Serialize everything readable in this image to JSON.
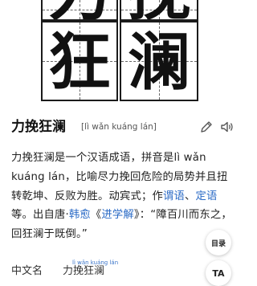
{
  "chars": [
    "力",
    "挽",
    "狂",
    "澜"
  ],
  "title": "力挽狂澜",
  "pinyin": "[lì wǎn kuáng lán]",
  "description": {
    "seg1": "力挽狂澜是一个汉语成语，拼音是lì wǎn kuáng lán，比喻尽力挽回危险的局势并且扭转乾坤、反败为胜。动宾式；作",
    "link1": "谓语",
    "seg2": "、",
    "link2": "定语",
    "seg3": "等。出自唐·",
    "link3": "韩愈",
    "seg4": "《",
    "link4": "进学解",
    "seg5": "》：“障百川而东之，回狂澜于既倒。”"
  },
  "toc_label": "目录",
  "ta_label": "TA",
  "info": {
    "label": "中文名",
    "value": "力挽狂澜",
    "value_pinyin": "lì wǎn kuáng lán"
  },
  "colors": {
    "link": "#2b6bc6",
    "text": "#222222"
  },
  "icons": {
    "edit": "pencil-icon",
    "sound": "speaker-icon"
  }
}
